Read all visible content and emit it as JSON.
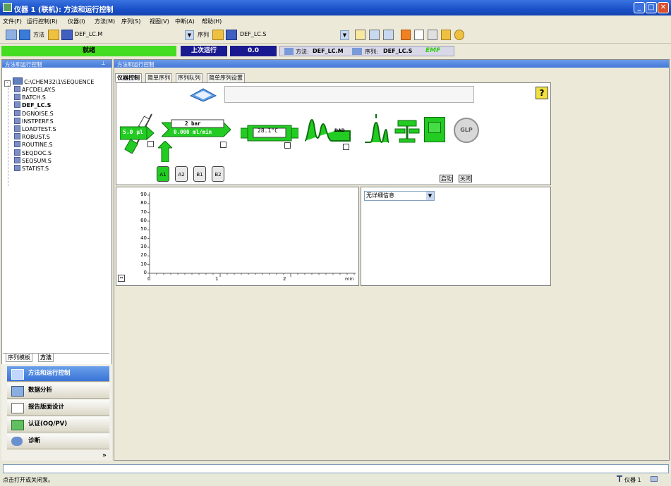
{
  "window": {
    "title": "仪器 1 (联机): 方法和运行控制",
    "min": "_",
    "max": "□",
    "close": "✕"
  },
  "menu": [
    "文件(F)",
    "运行控制(R)",
    "仪器(I)",
    "方法(M)",
    "序列(S)",
    "视图(V)",
    "中断(A)",
    "帮助(H)"
  ],
  "toolbar": {
    "method_label": "方法",
    "method_file": "DEF_LC.M",
    "sequence_label": "序列",
    "sequence_file": "DEF_LC.S"
  },
  "status": {
    "state": "就绪",
    "last_run_label": "上次运行",
    "last_run_value": "0.0",
    "method_label": "方法:",
    "method_value": "DEF_LC.M",
    "sequence_label": "序列:",
    "sequence_value": "DEF_LC.S",
    "emf": "EMF"
  },
  "left_panel": {
    "header": "方法和运行控制",
    "pin": "⊥",
    "tree_root": "C:\\CHEM32\\1\\SEQUENCE",
    "tree_items": [
      "AFCDELAY.S",
      "BATCH.S",
      "DEF_LC.S",
      "DGNOISE.S",
      "INSTPERF.S",
      "LOADTEST.S",
      "ROBUST.S",
      "ROUTINE.S",
      "SEQDOC.S",
      "SEQSUM.S",
      "STATIST.S"
    ],
    "selected": "DEF_LC.S",
    "tab_templates": "序列模板",
    "tab_methods": "方法"
  },
  "nav": {
    "items": [
      "方法和运行控制",
      "数据分析",
      "报告版面设计",
      "认证(OQ/PV)",
      "诊断"
    ],
    "chevron": "»"
  },
  "right_panel": {
    "header": "方法和运行控制",
    "tabs": [
      "仪器控制",
      "简单序列",
      "序列队列",
      "简单序列设置"
    ]
  },
  "instrument": {
    "pump_flow": "5.0 µl",
    "pressure": "2 bar",
    "flow": "0.000 ml/min",
    "temp": "28.1°C",
    "dad": "DAD",
    "glp": "GLP",
    "help": "?",
    "bottles": [
      "A1",
      "A2",
      "B1",
      "B2"
    ],
    "start_btn": "启动",
    "close_btn": "关闭"
  },
  "plot": {
    "yticks": [
      "90",
      "80",
      "70",
      "60",
      "50",
      "40",
      "30",
      "20",
      "10",
      "0"
    ],
    "xticks": [
      "0",
      "1",
      "2"
    ],
    "xunit": "min"
  },
  "info_combo": "无详细信息",
  "statusbar": {
    "text": "点击打开或关闭泵。",
    "instrument": "仪器 1"
  },
  "colors": {
    "title": "#1a50c8",
    "accent_green": "#22cc22",
    "status_green": "#44dd22",
    "run_blue": "#1a1a90"
  }
}
